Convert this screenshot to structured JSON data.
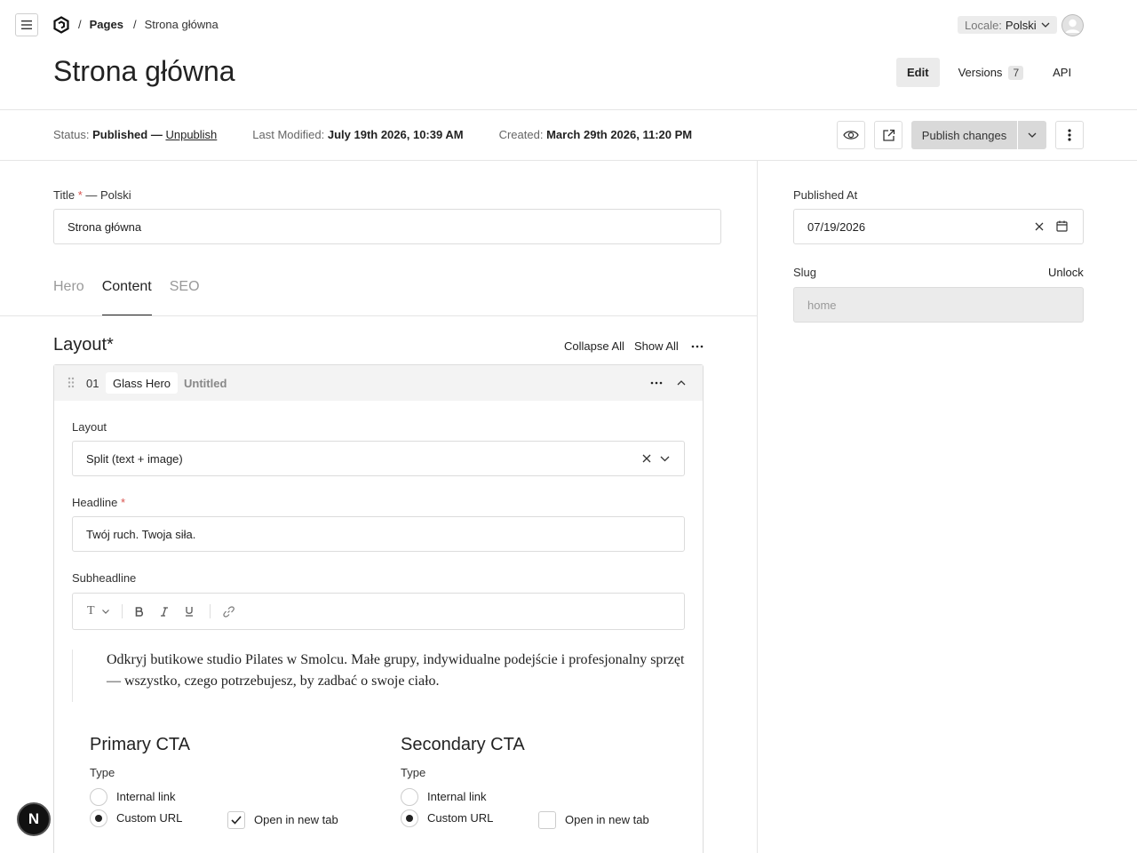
{
  "breadcrumb": {
    "section": "Pages",
    "current": "Strona główna",
    "sep": "/"
  },
  "locale": {
    "label": "Locale:",
    "value": "Polski"
  },
  "page": {
    "title": "Strona główna"
  },
  "view_tabs": {
    "edit": "Edit",
    "versions": "Versions",
    "versions_count": "7",
    "api": "API"
  },
  "status": {
    "status_label": "Status:",
    "status_value": "Published",
    "dash": "—",
    "unpublish": "Unpublish",
    "modified_label": "Last Modified:",
    "modified_value": "July 19th 2026, 10:39 AM",
    "created_label": "Created:",
    "created_value": "March 29th 2026, 11:20 PM"
  },
  "actions": {
    "publish": "Publish changes"
  },
  "title_field": {
    "label": "Title",
    "req": "*",
    "locale_suffix": "— Polski",
    "value": "Strona główna"
  },
  "tabs": [
    "Hero",
    "Content",
    "SEO"
  ],
  "layout": {
    "title": "Layout*",
    "collapse_all": "Collapse All",
    "show_all": "Show All"
  },
  "block": {
    "number": "01",
    "type": "Glass Hero",
    "name": "Untitled",
    "layout_label": "Layout",
    "layout_value": "Split (text + image)",
    "headline_label": "Headline",
    "headline_req": "*",
    "headline_value": "Twój ruch. Twoja siła.",
    "subheadline_label": "Subheadline",
    "toolbar_text": "T",
    "subheadline_text": "Odkryj butikowe studio Pilates w Smolcu. Małe grupy, indywidualne podejście i profesjonalny sprzęt — wszystko, czego potrzebujesz, by zadbać o swoje ciało."
  },
  "primary_cta": {
    "title": "Primary CTA",
    "type_label": "Type",
    "opt_internal": "Internal link",
    "opt_custom": "Custom URL",
    "new_tab": "Open in new tab",
    "new_tab_checked": true
  },
  "secondary_cta": {
    "title": "Secondary CTA",
    "type_label": "Type",
    "opt_internal": "Internal link",
    "opt_custom": "Custom URL",
    "new_tab": "Open in new tab",
    "new_tab_checked": false
  },
  "sidebar": {
    "published_at_label": "Published At",
    "published_at_value": "07/19/2026",
    "slug_label": "Slug",
    "unlock": "Unlock",
    "slug_value": "home"
  },
  "dev_badge": "N"
}
